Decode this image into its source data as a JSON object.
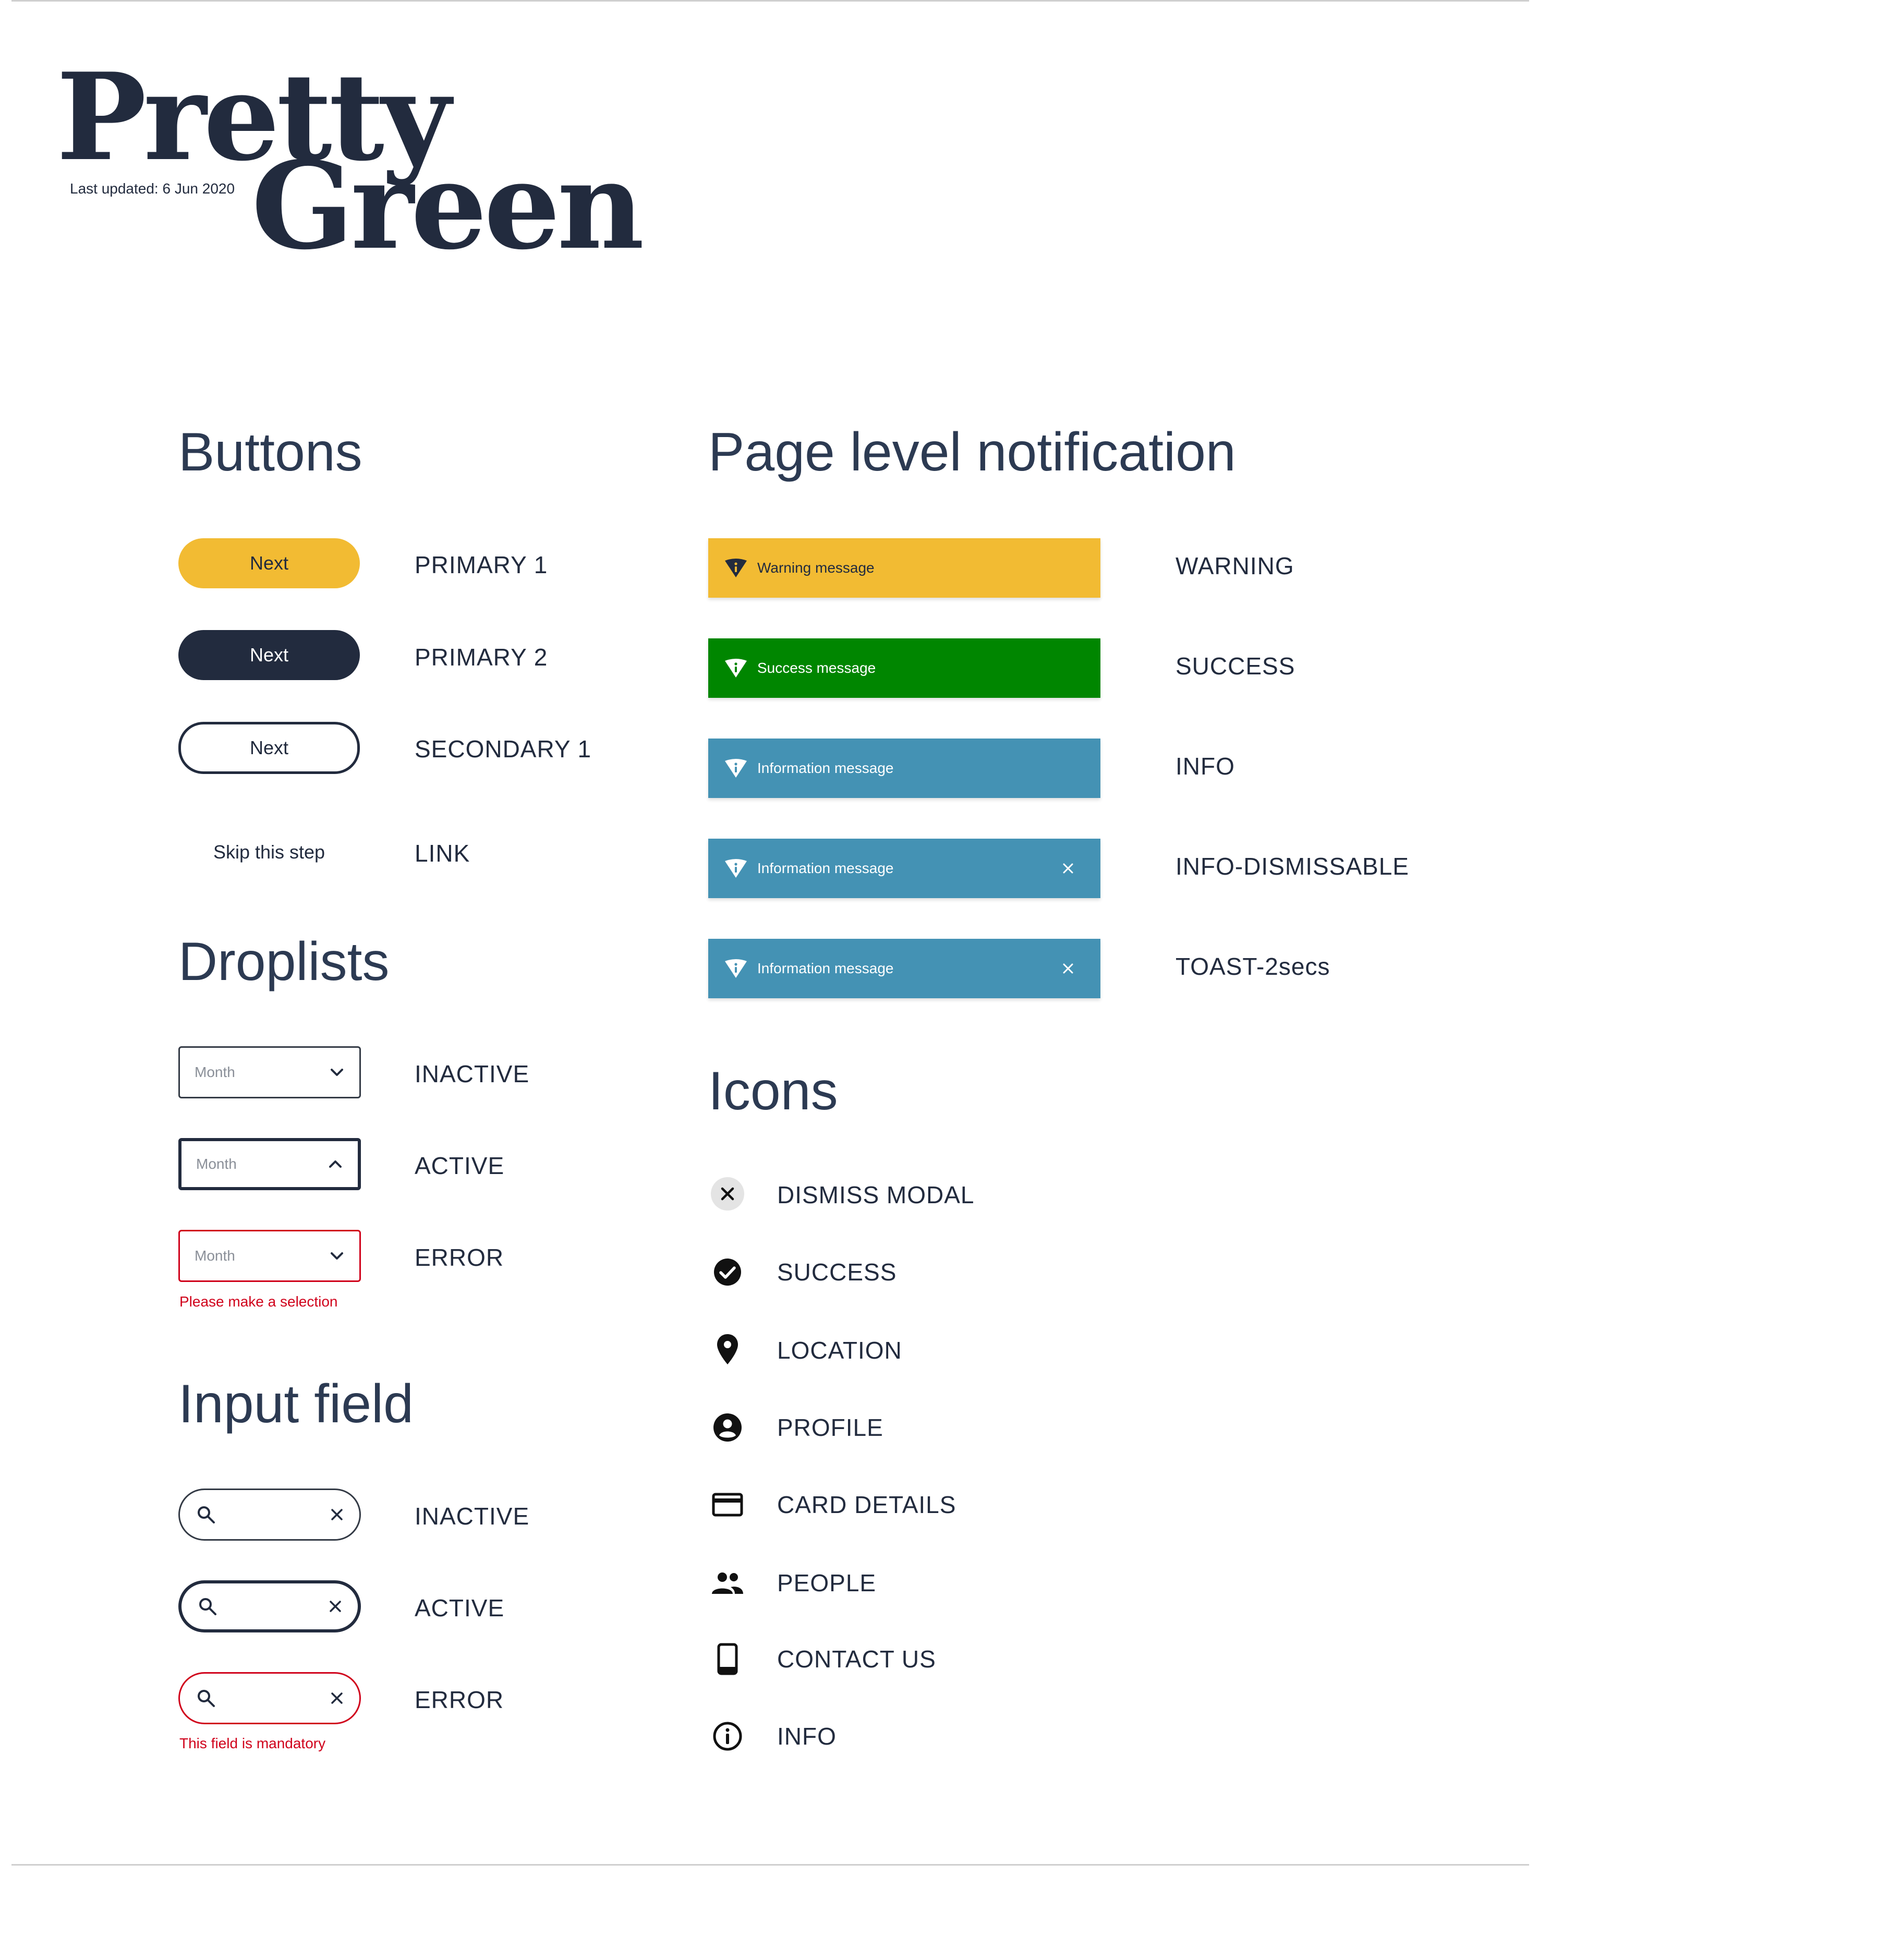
{
  "brand": {
    "word1": "Pretty",
    "word2": "Green",
    "last_updated": "Last updated: 6 Jun 2020"
  },
  "buttons": {
    "title": "Buttons",
    "items": [
      {
        "text": "Next",
        "label": "PRIMARY 1"
      },
      {
        "text": "Next",
        "label": "PRIMARY 2"
      },
      {
        "text": "Next",
        "label": "SECONDARY 1"
      },
      {
        "text": "Skip this step",
        "label": "LINK"
      }
    ]
  },
  "droplists": {
    "title": "Droplists",
    "items": [
      {
        "placeholder": "Month",
        "label": "INACTIVE"
      },
      {
        "placeholder": "Month",
        "label": "ACTIVE"
      },
      {
        "placeholder": "Month",
        "label": "ERROR"
      }
    ],
    "error_text": "Please make a selection"
  },
  "input_field": {
    "title": "Input field",
    "items": [
      {
        "label": "INACTIVE"
      },
      {
        "label": "ACTIVE"
      },
      {
        "label": "ERROR"
      }
    ],
    "error_text": "This field is mandatory"
  },
  "notifications": {
    "title": "Page level notification",
    "items": [
      {
        "message": "Warning message",
        "label": "WARNING"
      },
      {
        "message": "Success message",
        "label": "SUCCESS"
      },
      {
        "message": "Information message",
        "label": "INFO"
      },
      {
        "message": "Information message",
        "label": "INFO-DISMISSABLE"
      },
      {
        "message": "Information message",
        "label": "TOAST-2secs"
      }
    ]
  },
  "icons": {
    "title": "Icons",
    "items": [
      {
        "icon": "dismiss-modal-icon",
        "label": "DISMISS MODAL"
      },
      {
        "icon": "success-icon",
        "label": "SUCCESS"
      },
      {
        "icon": "location-icon",
        "label": "LOCATION"
      },
      {
        "icon": "profile-icon",
        "label": "PROFILE"
      },
      {
        "icon": "card-details-icon",
        "label": "CARD DETAILS"
      },
      {
        "icon": "people-icon",
        "label": "PEOPLE"
      },
      {
        "icon": "contact-us-icon",
        "label": "CONTACT US"
      },
      {
        "icon": "info-icon",
        "label": "INFO"
      }
    ]
  },
  "colors": {
    "navy": "#222b3e",
    "yellow": "#f2bb33",
    "green": "#008600",
    "info_blue": "#4492b4",
    "error_red": "#d0021b"
  }
}
